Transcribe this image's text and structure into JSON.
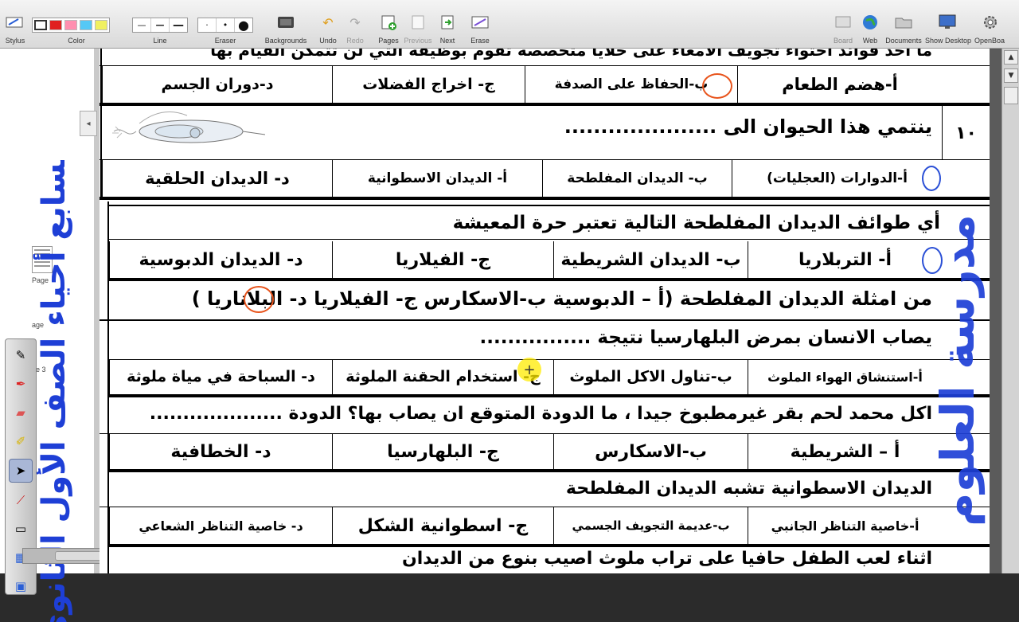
{
  "toolbar": {
    "stylus_label": "Stylus",
    "color_label": "Color",
    "line_label": "Line",
    "eraser_label": "Eraser",
    "backgrounds_label": "Backgrounds",
    "undo_label": "Undo",
    "redo_label": "Redo",
    "pages_label": "Pages",
    "previous_label": "Previous",
    "next_label": "Next",
    "erase_label": "Erase",
    "board_label": "Board",
    "web_label": "Web",
    "documents_label": "Documents",
    "show_desktop_label": "Show Desktop",
    "openboard_label": "OpenBoa",
    "colors": [
      "#ffffff",
      "#e02020",
      "#ff8fb0",
      "#56c8f5",
      "#f0f060"
    ]
  },
  "sidebar": {
    "vertical_title": "السابع أحياء الصف الأول الثانوي",
    "pages": [
      {
        "label": "Page"
      },
      {
        "label": "age"
      },
      {
        "label": "ge 3"
      }
    ]
  },
  "questions": {
    "q9_top_text": "ما أحد فوائد احتواء تجويف الأمعاء على خلايا متخصصة تقوم بوظيفة التي لن تتمكن القيام بها",
    "q9_options": [
      "أ-هضم الطعام",
      "ب-الحفاظ على الصدفة",
      "ج- اخراج الفضلات",
      "د-دوران الجسم"
    ],
    "q10_number": "١٠",
    "q10_text": "ينتمي هذا الحيوان الى .....................",
    "q10_options": [
      "أ-الدوارات (العجليات)",
      "ب- الديدان المفلطحة",
      "أ- الديدان الاسطوانية",
      "د- الديدان  الحلقية"
    ],
    "q11_text": "أي طوائف الديدان المفلطحة التالية تعتبر  حرة المعيشة",
    "q11_options": [
      "أ- التربلاريا",
      "ب- الديدان الشريطية",
      "ج- الفيلاريا",
      "د- الديدان الدبوسية"
    ],
    "q12_text": "من امثلة الديدان المفلطحة    (أ – الدبوسية ب-الاسكارس ج- الفيلاريا د- البلاناريا )",
    "q13_text": "يصاب الانسان بمرض البلهارسيا نتيجة ................",
    "q13_options": [
      "أ-استنشاق الهواء الملوث",
      "ب-تناول الاكل الملوث",
      "ج- استخدام الحقنة الملوثة",
      "د- السباحة في مياة ملوثة"
    ],
    "q14_text": "اكل محمد لحم بقر غيرمطبوخ  جيدا ، ما الدودة المتوقع ان يصاب بها؟ الدودة ....................",
    "q14_options": [
      "أ – الشريطية",
      "ب-الاسكارس",
      "ج- البلهارسيا",
      "د- الخطافية"
    ],
    "q15_text": "الديدان الاسطوانية تشبه الديدان المفلطحة",
    "q15_options": [
      "أ-خاصية التناظر الجانبي",
      "ب-عديمة التجويف الجسمي",
      "ج- اسطوانية الشكل",
      "د- خاصية التناظر الشعاعي"
    ],
    "q16_text": "اثناء لعب الطفل حافيا على تراب ملوث اصيب بنوع من الديدان"
  },
  "watermark": "مدرسة العلوم"
}
